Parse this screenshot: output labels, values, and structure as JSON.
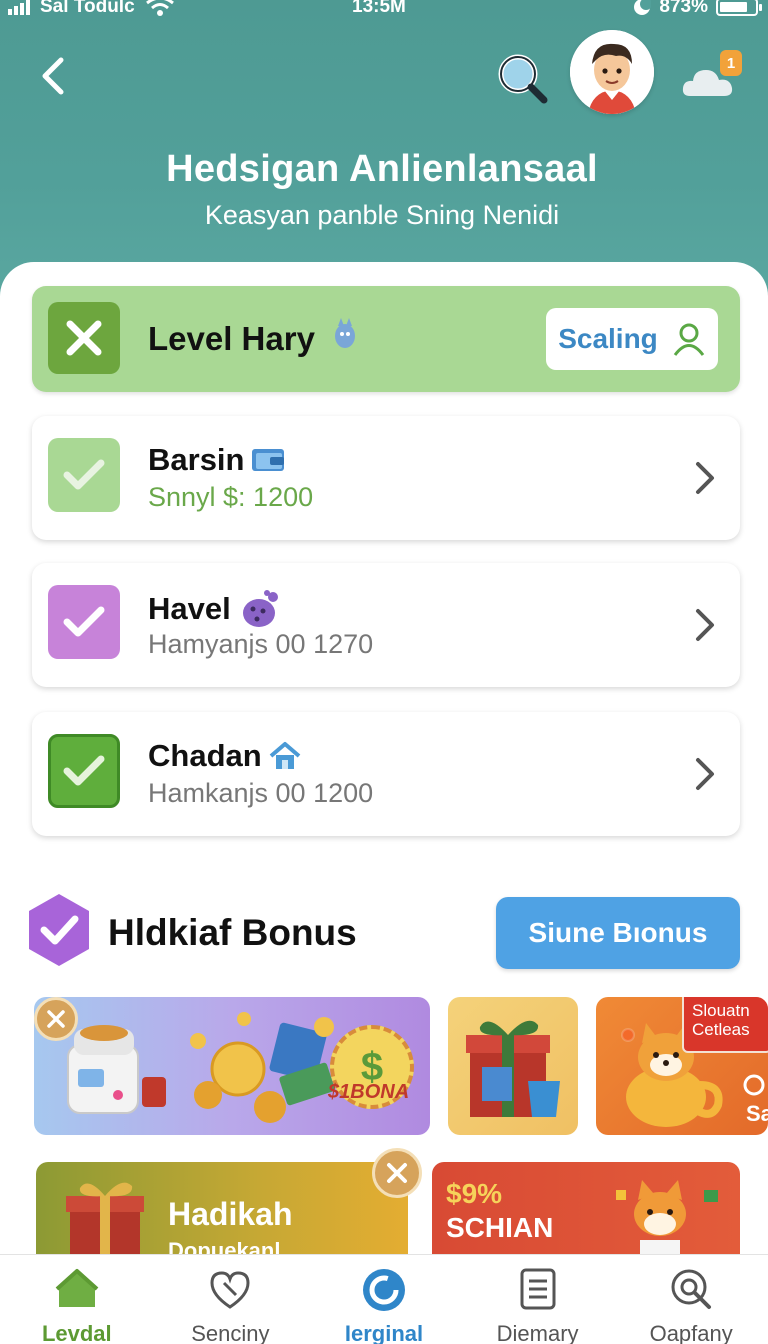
{
  "status_bar": {
    "carrier": "Sal Todulc",
    "time": "13:5M",
    "battery": "873%"
  },
  "header": {
    "title": "Hedsigan Anlienlansaal",
    "subtitle": "Keasyan panble Sning Nenidi",
    "notification_count": "1"
  },
  "level": {
    "title": "Level Hary",
    "scaling_label": "Scaling"
  },
  "tasks": [
    {
      "name": "Barsin",
      "meta": "Snnyl $: 1200",
      "check_color": "#a9d894"
    },
    {
      "name": "Havel",
      "meta": "Hamyanjs 00 1270",
      "check_color": "#c783d9"
    },
    {
      "name": "Chadan",
      "meta": "Hamkanjs 00 1200",
      "check_color": "#5fae3c"
    }
  ],
  "bonus": {
    "title": "Hldkiaf Bonus",
    "button_label": "Siune Bıonus",
    "promo_1_badge": "$1BONA",
    "promo_3_tag": "Slouatn Cetleas",
    "promo_3_side": "Sa",
    "promo_4_title": "Hadikah",
    "promo_4_sub": "Dopuekanl",
    "promo_5_price": "$9%",
    "promo_5_title": "SCHIAN"
  },
  "nav": [
    {
      "label": "Levdal",
      "icon": "home-icon"
    },
    {
      "label": "Senciny",
      "icon": "heart-tag-icon"
    },
    {
      "label": "Ierginal",
      "icon": "circle-refresh-icon"
    },
    {
      "label": "Diemary",
      "icon": "document-icon"
    },
    {
      "label": "Oapfany",
      "icon": "search-circle-icon"
    }
  ],
  "colors": {
    "header_teal": "#52a09a",
    "level_green": "#a9d894",
    "accent_blue": "#4fa2e4",
    "active_green": "#5d9a33"
  }
}
